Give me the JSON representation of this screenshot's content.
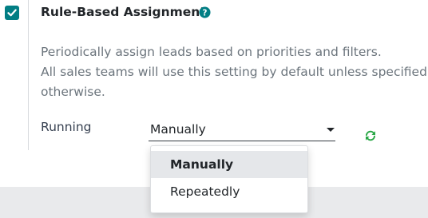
{
  "setting": {
    "title": "Rule-Based Assignment",
    "enabled": true,
    "help_icon": "question-circle-icon",
    "description": [
      "Periodically assign leads based on priorities and filters.",
      "All sales teams will use this setting by default unless specified",
      "otherwise."
    ]
  },
  "running": {
    "label": "Running",
    "value": "Manually",
    "refresh_icon": "refresh-icon",
    "options": [
      {
        "label": "Manually",
        "selected": true
      },
      {
        "label": "Repeatedly",
        "selected": false
      }
    ]
  },
  "colors": {
    "checkbox": "#017e84",
    "help_icon": "#017e84",
    "refresh_icon": "#28a745"
  }
}
